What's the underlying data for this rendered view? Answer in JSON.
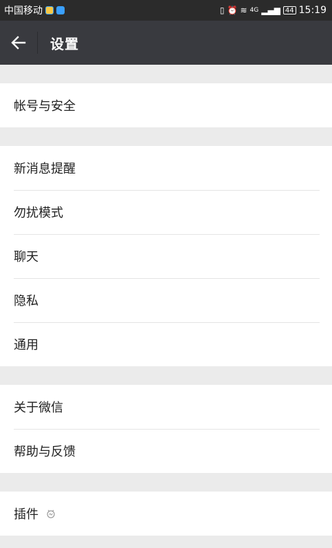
{
  "status_bar": {
    "carrier": "中国移动",
    "network": "4G",
    "battery": "44",
    "time": "15:19"
  },
  "header": {
    "title": "设置"
  },
  "groups": [
    {
      "items": [
        {
          "label": "帐号与安全"
        }
      ]
    },
    {
      "items": [
        {
          "label": "新消息提醒"
        },
        {
          "label": "勿扰模式"
        },
        {
          "label": "聊天"
        },
        {
          "label": "隐私"
        },
        {
          "label": "通用"
        }
      ]
    },
    {
      "items": [
        {
          "label": "关于微信"
        },
        {
          "label": "帮助与反馈"
        }
      ]
    },
    {
      "items": [
        {
          "label": "插件"
        }
      ]
    }
  ],
  "colors": {
    "title_bar": "#393a3f",
    "status_bar": "#2b2b2b",
    "background": "#ebebeb",
    "row": "#ffffff"
  }
}
